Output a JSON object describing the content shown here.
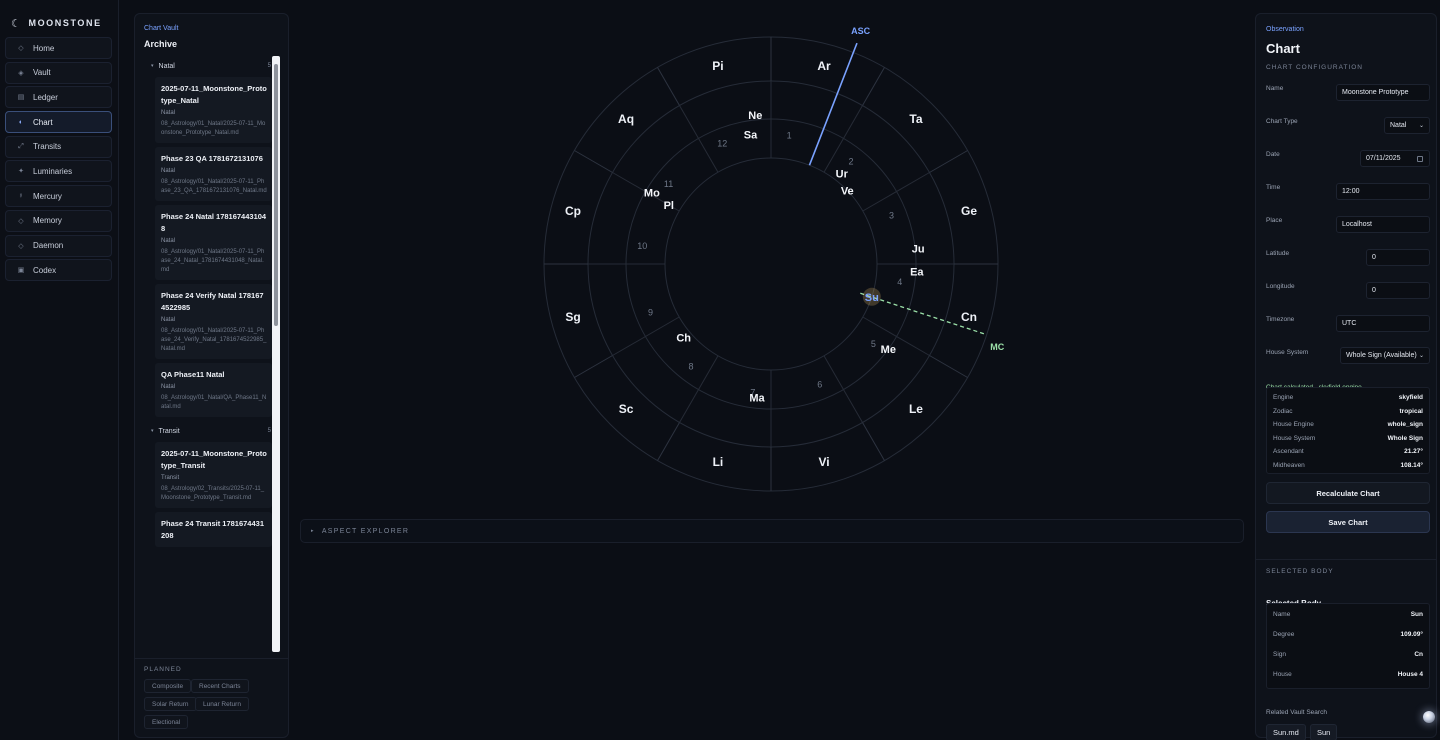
{
  "brand": {
    "name": "MOONSTONE"
  },
  "nav": {
    "items": [
      {
        "label": "Home",
        "icon": "home-icon",
        "glyph": "◇",
        "active": false
      },
      {
        "label": "Vault",
        "icon": "vault-icon",
        "glyph": "◈",
        "active": false
      },
      {
        "label": "Ledger",
        "icon": "ledger-icon",
        "glyph": "▤",
        "active": false
      },
      {
        "label": "Chart",
        "icon": "chart-icon",
        "glyph": "◐",
        "active": true
      },
      {
        "label": "Transits",
        "icon": "transits-icon",
        "glyph": "⤢",
        "active": false
      },
      {
        "label": "Luminaries",
        "icon": "luminaries-icon",
        "glyph": "✦",
        "active": false
      },
      {
        "label": "Mercury",
        "icon": "mercury-icon",
        "glyph": "☿",
        "active": false
      },
      {
        "label": "Memory",
        "icon": "memory-icon",
        "glyph": "◇",
        "active": false
      },
      {
        "label": "Daemon",
        "icon": "daemon-icon",
        "glyph": "◇",
        "active": false
      },
      {
        "label": "Codex",
        "icon": "codex-icon",
        "glyph": "▣",
        "active": false
      }
    ]
  },
  "archive": {
    "kicker": "Chart Vault",
    "title": "Archive",
    "groups": [
      {
        "name": "Natal",
        "count": "5",
        "items": [
          {
            "title": "2025-07-11_Moonstone_Prototype_Natal",
            "kind": "Natal",
            "path": "08_Astrology/01_Natal/2025-07-11_Moonstone_Prototype_Natal.md"
          },
          {
            "title": "Phase 23 QA 1781672131076",
            "kind": "Natal",
            "path": "08_Astrology/01_Natal/2025-07-11_Phase_23_QA_1781672131076_Natal.md"
          },
          {
            "title": "Phase 24 Natal 1781674431048",
            "kind": "Natal",
            "path": "08_Astrology/01_Natal/2025-07-11_Phase_24_Natal_1781674431048_Natal.md"
          },
          {
            "title": "Phase 24 Verify Natal 1781674522985",
            "kind": "Natal",
            "path": "08_Astrology/01_Natal/2025-07-11_Phase_24_Verify_Natal_1781674522985_Natal.md"
          },
          {
            "title": "QA Phase11 Natal",
            "kind": "Natal",
            "path": "08_Astrology/01_Natal/QA_Phase11_Natal.md"
          }
        ]
      },
      {
        "name": "Transit",
        "count": "5",
        "items": [
          {
            "title": "2025-07-11_Moonstone_Prototype_Transit",
            "kind": "Transit",
            "path": "08_Astrology/02_Transits/2025-07-11_Moonstone_Prototype_Transit.md"
          },
          {
            "title": "Phase 24 Transit 1781674431208",
            "kind": "",
            "path": ""
          }
        ]
      }
    ],
    "planned_label": "PLANNED",
    "planned": [
      "Composite",
      "Recent Charts",
      "Solar Return",
      "Lunar Return",
      "Electional"
    ]
  },
  "wheel": {
    "signs": [
      "Ar",
      "Ta",
      "Ge",
      "Cn",
      "Le",
      "Vi",
      "Li",
      "Sc",
      "Sg",
      "Cp",
      "Aq",
      "Pi"
    ],
    "houses": [
      "1",
      "2",
      "3",
      "4",
      "5",
      "6",
      "7",
      "8",
      "9",
      "10",
      "11",
      "12"
    ],
    "asc_label": "ASC",
    "mc_label": "MC",
    "ascendant_deg": 21.27,
    "midheaven_deg": 108.14,
    "selected_body": "Su",
    "bodies": [
      {
        "label": "Ne"
      },
      {
        "label": "Sa"
      },
      {
        "label": "Ur"
      },
      {
        "label": "Ve"
      },
      {
        "label": "Ju"
      },
      {
        "label": "Ea"
      },
      {
        "label": "Su"
      },
      {
        "label": "Me"
      },
      {
        "label": "Ma"
      },
      {
        "label": "Ch"
      },
      {
        "label": "Pl"
      },
      {
        "label": "Mo"
      }
    ],
    "colors": {
      "asc": "#7aa2ff",
      "mc": "#9be0a8",
      "ring": "#262c38",
      "sign": "#eef1f7",
      "house": "#6f7888"
    }
  },
  "aspect_explorer": {
    "label": "ASPECT EXPLORER"
  },
  "panel": {
    "kicker": "Observation",
    "title": "Chart",
    "config_label": "CHART CONFIGURATION",
    "fields": {
      "name": {
        "label": "Name",
        "value": "Moonstone Prototype"
      },
      "chart_type": {
        "label": "Chart Type",
        "value": "Natal"
      },
      "date": {
        "label": "Date",
        "value": "07/11/2025"
      },
      "time": {
        "label": "Time",
        "value": "12:00"
      },
      "place": {
        "label": "Place",
        "value": "Localhost"
      },
      "latitude": {
        "label": "Latitude",
        "value": "0"
      },
      "longitude": {
        "label": "Longitude",
        "value": "0"
      },
      "timezone": {
        "label": "Timezone",
        "value": "UTC"
      },
      "house_system": {
        "label": "House System",
        "value": "Whole Sign (Available)"
      }
    },
    "calc_message": "Chart calculated - skyfield engine",
    "engine_info": [
      {
        "k": "Engine",
        "v": "skyfield"
      },
      {
        "k": "Zodiac",
        "v": "tropical"
      },
      {
        "k": "House Engine",
        "v": "whole_sign"
      },
      {
        "k": "House System",
        "v": "Whole Sign"
      },
      {
        "k": "Ascendant",
        "v": "21.27°"
      },
      {
        "k": "Midheaven",
        "v": "108.14°"
      }
    ],
    "recalculate_label": "Recalculate Chart",
    "save_label": "Save Chart",
    "selected_section": "SELECTED BODY",
    "selected_title": "Selected Body",
    "selected": [
      {
        "k": "Name",
        "v": "Sun"
      },
      {
        "k": "Degree",
        "v": "109.09°"
      },
      {
        "k": "Sign",
        "v": "Cn"
      },
      {
        "k": "House",
        "v": "House 4"
      }
    ],
    "related_label": "Related Vault Search",
    "related": [
      "Sun.md",
      "Sun"
    ]
  }
}
